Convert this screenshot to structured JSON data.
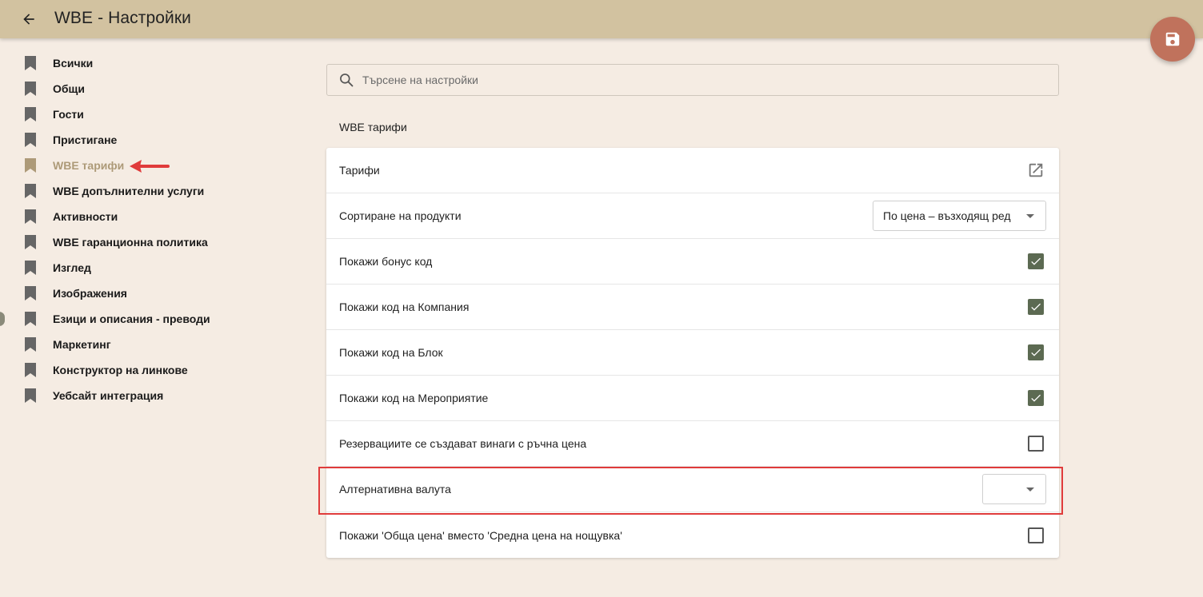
{
  "header": {
    "title": "WBE - Настройки",
    "back_icon": "arrow-left-icon",
    "save_icon": "floppy-disk-icon"
  },
  "colors": {
    "topbar": "#d2c2a0",
    "background": "#f5ece3",
    "fab": "#c0725c",
    "active_nav": "#ad9a78",
    "checkbox_checked": "#5c6a52",
    "annotation": "#e03b3b"
  },
  "sidebar": {
    "icon": "bookmark-icon",
    "items": [
      {
        "label": "Всички"
      },
      {
        "label": "Общи"
      },
      {
        "label": "Гости"
      },
      {
        "label": "Пристигане"
      },
      {
        "label": "WBE тарифи",
        "active": true
      },
      {
        "label": "WBE допълнителни услуги"
      },
      {
        "label": "Активности"
      },
      {
        "label": "WBE гаранционна политика"
      },
      {
        "label": "Изглед"
      },
      {
        "label": "Изображения"
      },
      {
        "label": "Езици и описания - преводи"
      },
      {
        "label": "Маркетинг"
      },
      {
        "label": "Конструктор на линкове"
      },
      {
        "label": "Уебсайт интеграция"
      }
    ]
  },
  "search": {
    "placeholder": "Търсене на настройки",
    "icon": "search-icon"
  },
  "section": {
    "title": "WBE тарифи"
  },
  "settings": [
    {
      "label": "Тарифи",
      "control": "link",
      "icon": "open-in-new-icon"
    },
    {
      "label": "Сортиране на продукти",
      "control": "select",
      "value": "По цена – възходящ ред"
    },
    {
      "label": "Покажи бонус код",
      "control": "checkbox",
      "checked": true
    },
    {
      "label": "Покажи код на Компания",
      "control": "checkbox",
      "checked": true
    },
    {
      "label": "Покажи код на Блок",
      "control": "checkbox",
      "checked": true
    },
    {
      "label": "Покажи код на Мероприятие",
      "control": "checkbox",
      "checked": true
    },
    {
      "label": "Резервациите се създават винаги с ръчна цена",
      "control": "checkbox",
      "checked": false
    },
    {
      "label": "Алтернативна валута",
      "control": "select",
      "value": ""
    },
    {
      "label": "Покажи 'Обща цена' вместо 'Средна цена на нощувка'",
      "control": "checkbox",
      "checked": false
    }
  ]
}
